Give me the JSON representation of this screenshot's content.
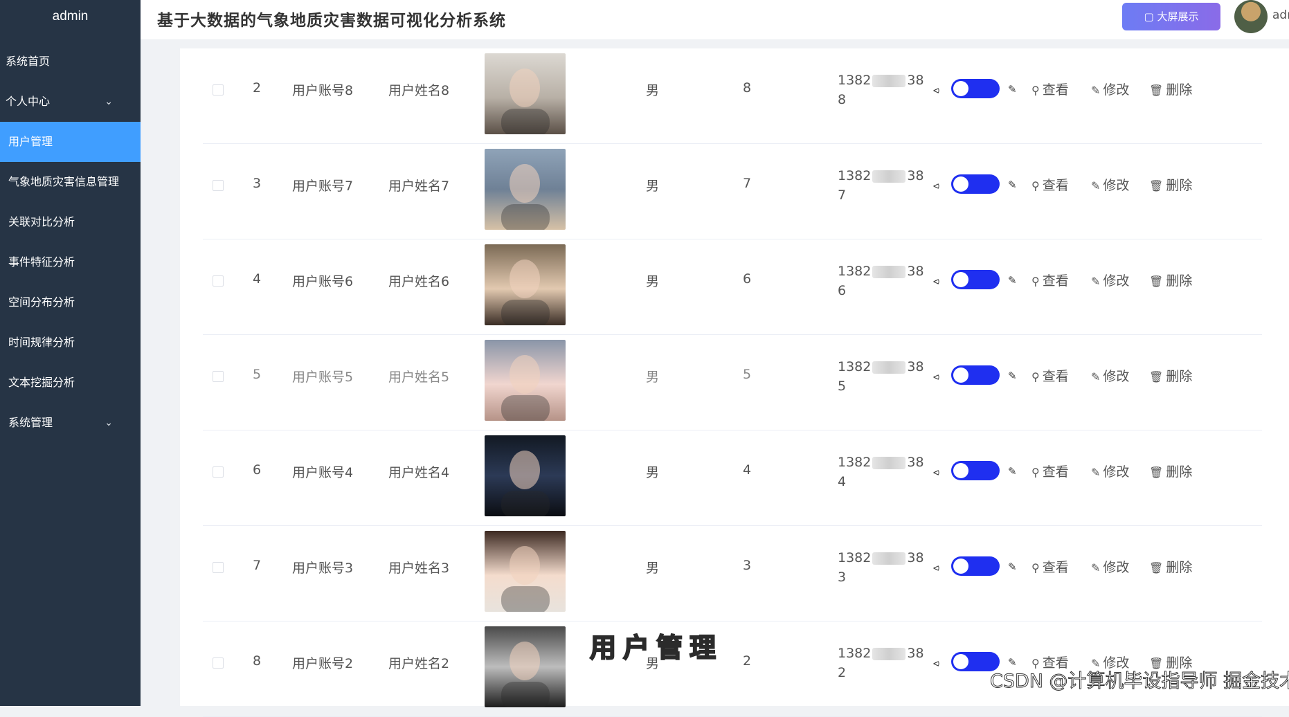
{
  "sidebar": {
    "brand": "admin",
    "items": [
      {
        "label": "系统首页",
        "chevron": false
      },
      {
        "label": "个人中心",
        "chevron": true
      },
      {
        "label": "用户管理",
        "chevron": false
      },
      {
        "label": "气象地质灾害信息管理",
        "chevron": false
      },
      {
        "label": "关联对比分析",
        "chevron": false
      },
      {
        "label": "事件特征分析",
        "chevron": false
      },
      {
        "label": "空间分布分析",
        "chevron": false
      },
      {
        "label": "时间规律分析",
        "chevron": false
      },
      {
        "label": "文本挖掘分析",
        "chevron": false
      },
      {
        "label": "系统管理",
        "chevron": true
      }
    ]
  },
  "header": {
    "title": "基于大数据的气象地质灾害数据可视化分析系统",
    "screen_button": "大屏展示",
    "user": "adı"
  },
  "table": {
    "actions": {
      "view": "查看",
      "edit": "修改",
      "delete": "删除"
    },
    "rows": [
      {
        "index": "2",
        "account": "用户账号8",
        "name": "用户姓名8",
        "gender": "男",
        "age": "8",
        "phone_prefix": "1382",
        "phone_suffix": "38",
        "phone_last": "8"
      },
      {
        "index": "3",
        "account": "用户账号7",
        "name": "用户姓名7",
        "gender": "男",
        "age": "7",
        "phone_prefix": "1382",
        "phone_suffix": "38",
        "phone_last": "7"
      },
      {
        "index": "4",
        "account": "用户账号6",
        "name": "用户姓名6",
        "gender": "男",
        "age": "6",
        "phone_prefix": "1382",
        "phone_suffix": "38",
        "phone_last": "6"
      },
      {
        "index": "5",
        "account": "用户账号5",
        "name": "用户姓名5",
        "gender": "男",
        "age": "5",
        "phone_prefix": "1382",
        "phone_suffix": "38",
        "phone_last": "5"
      },
      {
        "index": "6",
        "account": "用户账号4",
        "name": "用户姓名4",
        "gender": "男",
        "age": "4",
        "phone_prefix": "1382",
        "phone_suffix": "38",
        "phone_last": "4"
      },
      {
        "index": "7",
        "account": "用户账号3",
        "name": "用户姓名3",
        "gender": "男",
        "age": "3",
        "phone_prefix": "1382",
        "phone_suffix": "38",
        "phone_last": "3"
      },
      {
        "index": "8",
        "account": "用户账号2",
        "name": "用户姓名2",
        "gender": "男",
        "age": "2",
        "phone_prefix": "1382",
        "phone_suffix": "38",
        "phone_last": "2"
      }
    ]
  },
  "overlay": {
    "caption": "用户管理",
    "watermark": "CSDN @计算机毕设指导师 掘金技术社区"
  }
}
